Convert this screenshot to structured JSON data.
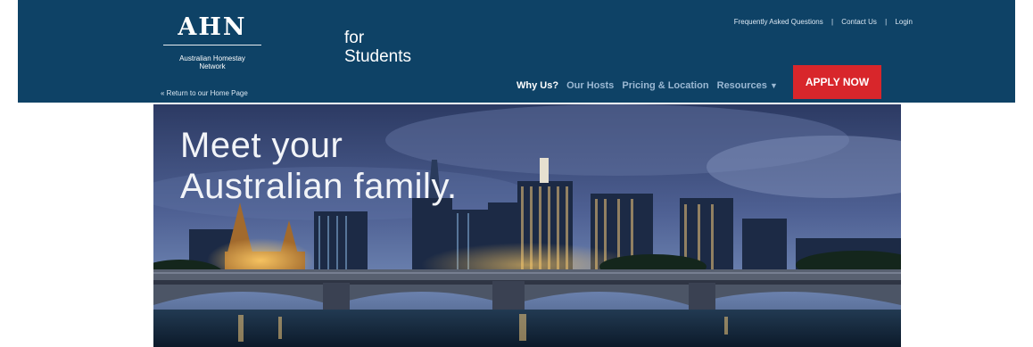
{
  "logo": {
    "mark": "AHN",
    "subtitle_line1": "Australian Homestay",
    "subtitle_line2": "Network"
  },
  "header": {
    "tagline_line1": "for",
    "tagline_line2": "Students",
    "return_link": "« Return to our Home Page"
  },
  "top_links": {
    "faq": "Frequently Asked Questions",
    "contact": "Contact Us",
    "login": "Login",
    "separator": "|"
  },
  "nav": {
    "items": [
      {
        "label": "Why Us?"
      },
      {
        "label": "Our Hosts"
      },
      {
        "label": "Pricing & Location"
      },
      {
        "label": "Resources"
      }
    ],
    "dropdown_glyph": "▼"
  },
  "cta": {
    "label": "APPLY NOW"
  },
  "hero": {
    "line1": "Meet your",
    "line2": "Australian family."
  },
  "colors": {
    "header_bg": "#0e4266",
    "cta_bg": "#d8262b",
    "nav_active": "#ffffff",
    "nav_inactive": "#9bb8d3"
  }
}
